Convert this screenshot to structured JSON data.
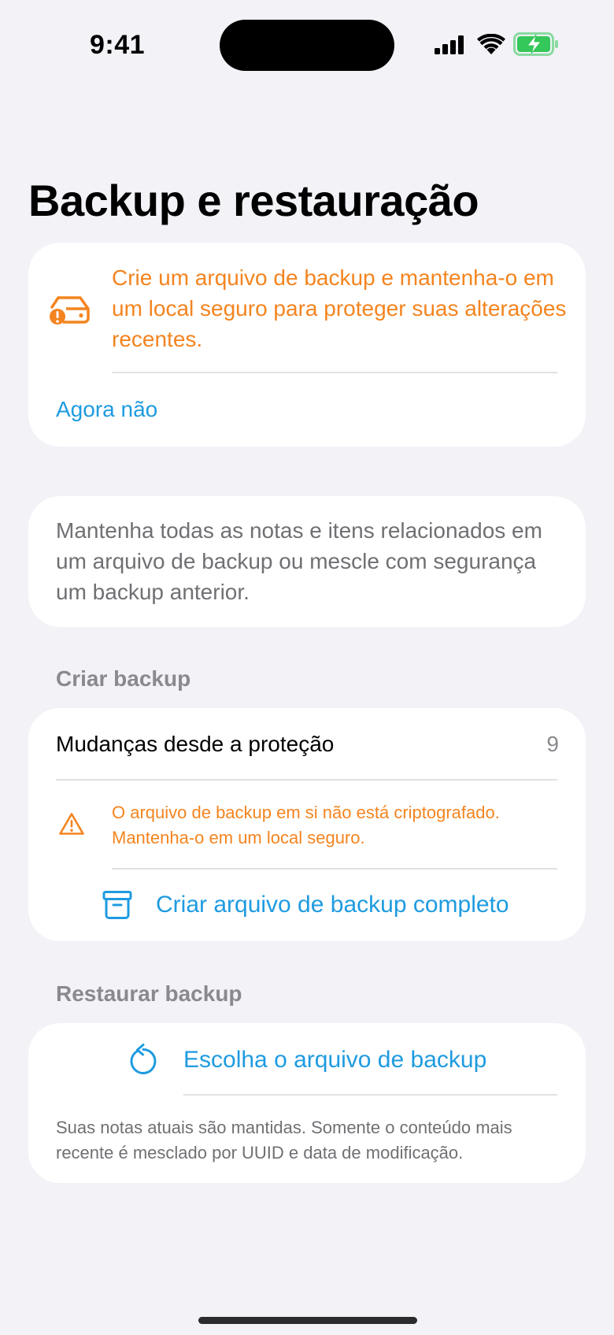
{
  "status_bar": {
    "time": "9:41",
    "icons": [
      "cellular-signal-icon",
      "wifi-icon",
      "battery-charging-icon"
    ],
    "battery_color": "#34c759"
  },
  "page": {
    "title": "Backup e restauração"
  },
  "reminder_card": {
    "icon": "drive-warning-icon",
    "message": "Crie um arquivo de backup e mantenha-o em um local seguro para proteger suas alterações recentes.",
    "dismiss_label": "Agora não"
  },
  "info_card": {
    "description": "Mantenha todas as notas e itens relacionados em um arquivo de backup ou mescle com segurança um backup anterior."
  },
  "create_section": {
    "label": "Criar backup",
    "changes_label": "Mudanças desde a proteção",
    "changes_count": "9",
    "warning_icon": "warning-triangle-icon",
    "warning_text": "O arquivo de backup em si não está criptografado. Mantenha-o em um local seguro.",
    "action_icon": "archive-box-icon",
    "action_label": "Criar arquivo de backup completo"
  },
  "restore_section": {
    "label": "Restaurar backup",
    "action_icon": "restore-arrow-icon",
    "action_label": "Escolha o arquivo de backup",
    "note": "Suas notas atuais são mantidas. Somente o conteúdo mais recente é mesclado por UUID e data de modificação."
  },
  "colors": {
    "accent_blue": "#1e9be0",
    "warning_orange": "#f4841f",
    "background": "#f2f2f7"
  }
}
